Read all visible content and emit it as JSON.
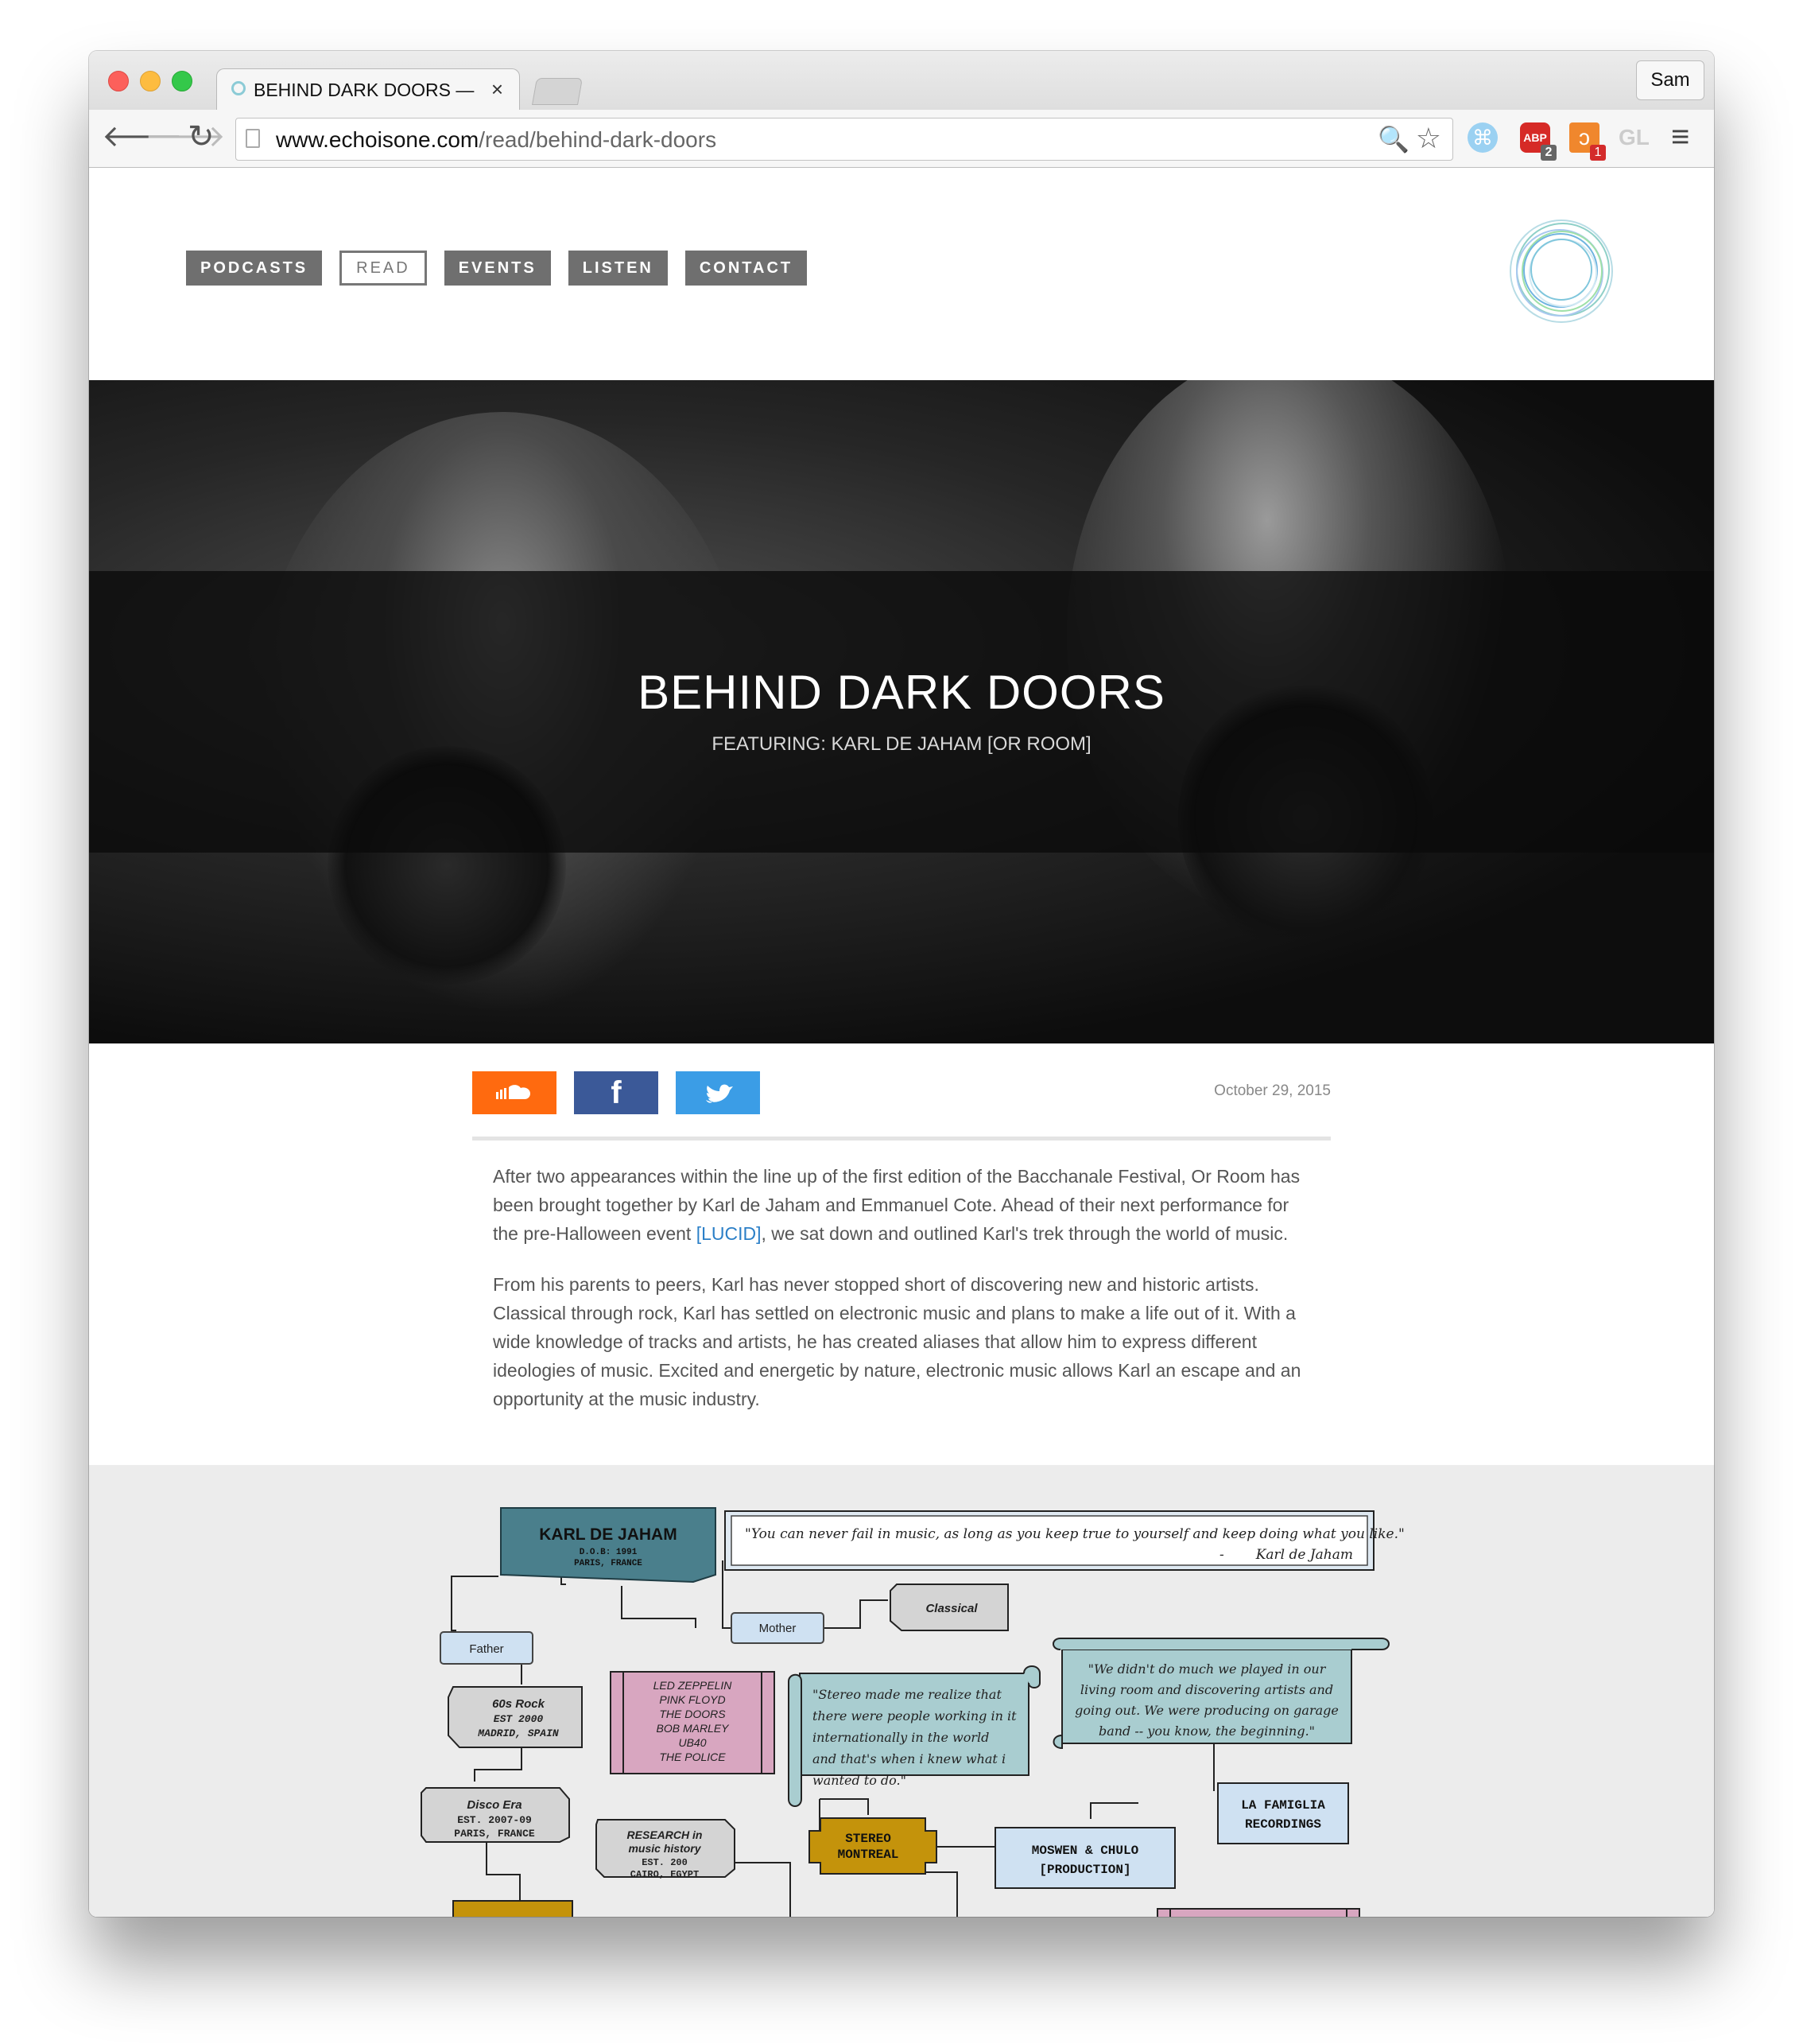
{
  "browser": {
    "tab_title": "BEHIND DARK DOORS — E",
    "tab_close": "×",
    "profile_name": "Sam",
    "url_host": "www.echoisone.com",
    "url_path": "/read/behind-dark-doors",
    "extensions": {
      "ext1_glyph": "⌘",
      "abp_label": "ABP",
      "abp_badge": "2",
      "hub_glyph": "ↄ",
      "hub_badge": "1",
      "gl_label": "GL"
    },
    "icons": {
      "back": "🡐",
      "forward": "🡒",
      "reload": "↻",
      "search": "🔍",
      "star": "☆",
      "menu": "≡"
    }
  },
  "site": {
    "nav": [
      "PODCASTS",
      "READ",
      "EVENTS",
      "LISTEN",
      "CONTACT"
    ],
    "active_nav": "READ",
    "accent_color": "#6f6f6f"
  },
  "hero": {
    "title": "BEHIND DARK DOORS",
    "subtitle": "FEATURING: KARL DE JAHAM [OR ROOM]"
  },
  "post": {
    "date": "October 29, 2015",
    "share": {
      "soundcloud_color": "#ff6a0f",
      "facebook_label": "f",
      "facebook_color": "#3b5998",
      "twitter_color": "#3b9de6"
    },
    "p1_before": "After two appearances within the line up of the first edition of the Bacchanale Festival, Or Room has been brought together by Karl de Jaham and Emmanuel Cote. Ahead of their next performance for the pre-Halloween event ",
    "p1_link": "[LUCID]",
    "p1_after": ", we sat down and outlined Karl's trek through the world of music.",
    "p2": "From his parents to peers, Karl has never stopped short of discovering new and historic artists. Classical through rock, Karl has settled on electronic music and plans to make a life out of it. With a wide knowledge of tracks and artists, he has created aliases that allow him to express different ideologies of music. Excited and energetic by nature, electronic music allows Karl an escape and an opportunity at the music industry."
  },
  "diagram": {
    "main_name": "KARL DE JAHAM",
    "main_dob": "D.O.B: 1991",
    "main_place": "PARIS, FRANCE",
    "quote_top": "\"You can never fail in music, as long as you keep true to yourself and keep doing what you like.\"",
    "quote_top_dash": "-",
    "quote_top_author": "Karl de Jaham",
    "mother": "Mother",
    "father": "Father",
    "classical": "Classical",
    "rock_l1": "60s Rock",
    "rock_l2": "EST 2000",
    "rock_l3": "MADRID, SPAIN",
    "bands": [
      "LED ZEPPELIN",
      "PINK FLOYD",
      "THE DOORS",
      "BOB MARLEY",
      "UB40",
      "THE POLICE"
    ],
    "scroll1": [
      "\"Stereo made me realize that",
      "there were people working in it",
      "internationally in the world",
      "and that's when i knew what i",
      "wanted to do.\""
    ],
    "scroll2": [
      "\"We didn't do much we played in our",
      "living room and discovering artists and",
      "going out. We were producing on garage",
      "band -- you know, the beginning.\""
    ],
    "disco_l1": "Disco Era",
    "disco_l2": "EST. 2007-09",
    "disco_l3": "PARIS, FRANCE",
    "research_l1": "RESEARCH in",
    "research_l2": "music history",
    "research_l3": "EST. 200",
    "research_l4": "CAIRO, EGYPT",
    "stereo_l1": "STEREO",
    "stereo_l2": "MONTREAL",
    "moswen_l1": "MOSWEN & CHULO",
    "moswen_l2": "[PRODUCTION]",
    "famiglia_l1": "LA FAMIGLIA",
    "famiglia_l2": "RECORDINGS",
    "colors": {
      "teal": "#4a7f8c",
      "light_blue": "#cfe1f2",
      "grey": "#d4d4d4",
      "pink": "#d8a6c0",
      "mustard": "#c4930b",
      "scroll": "#a9cdd0"
    }
  }
}
